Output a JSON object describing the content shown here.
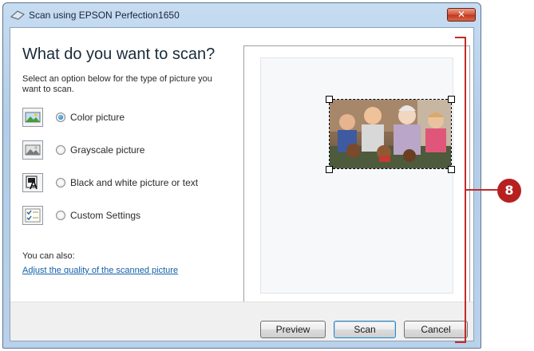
{
  "window": {
    "title": "Scan using EPSON Perfection1650",
    "close_glyph": "✕"
  },
  "main": {
    "heading": "What do you want to scan?",
    "instructions": "Select an option below for the type of picture you want to scan.",
    "options": [
      {
        "label": "Color picture",
        "icon": "color-picture-icon",
        "selected": true
      },
      {
        "label": "Grayscale picture",
        "icon": "grayscale-picture-icon",
        "selected": false
      },
      {
        "label": "Black and white picture or text",
        "icon": "bw-text-icon",
        "selected": false
      },
      {
        "label": "Custom Settings",
        "icon": "custom-settings-icon",
        "selected": false
      }
    ],
    "also_label": "You can also:",
    "quality_link": "Adjust the quality of the scanned picture"
  },
  "buttons": {
    "preview": "Preview",
    "scan": "Scan",
    "cancel": "Cancel"
  },
  "callout": {
    "number": "8",
    "color": "#b62020"
  }
}
